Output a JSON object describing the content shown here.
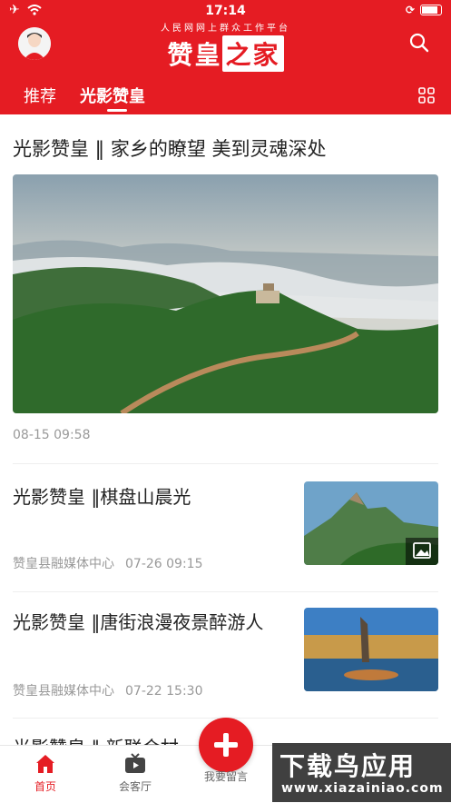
{
  "status_bar": {
    "time": "17:14"
  },
  "header": {
    "subtitle": "人民网网上群众工作平台",
    "logo_part1": "赞皇",
    "logo_part2": "之家"
  },
  "tabs": [
    {
      "label": "推荐"
    },
    {
      "label": "光影赞皇"
    }
  ],
  "hero": {
    "title": "光影赞皇 ‖ 家乡的瞭望 美到灵魂深处",
    "time": "08-15 09:58"
  },
  "articles": [
    {
      "title": "光影赞皇 ‖棋盘山晨光",
      "source": "赞皇县融媒体中心",
      "time": "07-26 09:15"
    },
    {
      "title": "光影赞皇 ‖唐街浪漫夜景醉游人",
      "source": "赞皇县融媒体中心",
      "time": "07-22 15:30"
    },
    {
      "title": "光影赞皇 ‖ 新联合村 ... 晚"
    }
  ],
  "bottom_nav": [
    {
      "label": "首页"
    },
    {
      "label": "会客厅"
    },
    {
      "label": "我要留言"
    }
  ],
  "watermark": {
    "big": "下载鸟应用",
    "small": "www.xiazainiao.com"
  },
  "colors": {
    "brand": "#e51c23"
  }
}
